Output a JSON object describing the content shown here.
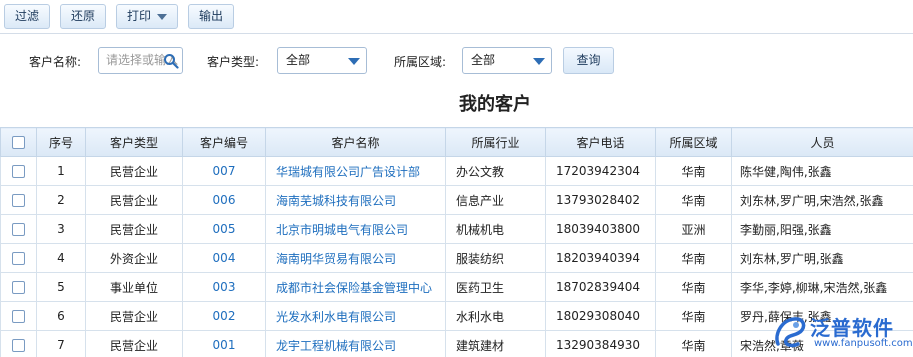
{
  "toolbar": {
    "filter_label": "过滤",
    "restore_label": "还原",
    "print_label": "打印",
    "export_label": "输出"
  },
  "filters": {
    "customer_name_label": "客户名称:",
    "customer_name_placeholder": "请选择或输入",
    "customer_type_label": "客户类型:",
    "customer_type_value": "全部",
    "region_label": "所属区域:",
    "region_value": "全部",
    "query_label": "查询"
  },
  "page_title": "我的客户",
  "table": {
    "headers": [
      "序号",
      "客户类型",
      "客户编号",
      "客户名称",
      "所属行业",
      "客户电话",
      "所属区域",
      "人员"
    ],
    "rows": [
      {
        "no": "1",
        "type": "民营企业",
        "code": "007",
        "name": "华瑞城有限公司广告设计部",
        "industry": "办公文教",
        "phone": "17203942304",
        "region": "华南",
        "people": "陈华健,陶伟,张鑫"
      },
      {
        "no": "2",
        "type": "民营企业",
        "code": "006",
        "name": "海南芜城科技有限公司",
        "industry": "信息产业",
        "phone": "13793028402",
        "region": "华南",
        "people": "刘东林,罗广明,宋浩然,张鑫"
      },
      {
        "no": "3",
        "type": "民营企业",
        "code": "005",
        "name": "北京市明城电气有限公司",
        "industry": "机械机电",
        "phone": "18039403800",
        "region": "亚洲",
        "people": "李勤丽,阳强,张鑫"
      },
      {
        "no": "4",
        "type": "外资企业",
        "code": "004",
        "name": "海南明华贸易有限公司",
        "industry": "服装纺织",
        "phone": "18203940394",
        "region": "华南",
        "people": "刘东林,罗广明,张鑫"
      },
      {
        "no": "5",
        "type": "事业单位",
        "code": "003",
        "name": "成都市社会保险基金管理中心",
        "industry": "医药卫生",
        "phone": "18702839404",
        "region": "华南",
        "people": "李华,李婷,柳琳,宋浩然,张鑫"
      },
      {
        "no": "6",
        "type": "民营企业",
        "code": "002",
        "name": "光发水利水电有限公司",
        "industry": "水利水电",
        "phone": "18029308040",
        "region": "华南",
        "people": "罗丹,薛保丰,张鑫"
      },
      {
        "no": "7",
        "type": "民营企业",
        "code": "001",
        "name": "龙宇工程机械有限公司",
        "industry": "建筑建材",
        "phone": "13290384930",
        "region": "华南",
        "people": "宋浩然,章薇"
      }
    ]
  },
  "watermark": {
    "brand": "泛普软件",
    "url": "www.fanpusoft.com"
  },
  "colors": {
    "link": "#1e6ebe",
    "header_bg": "#dbe8f6",
    "accent": "#2d6db5"
  }
}
